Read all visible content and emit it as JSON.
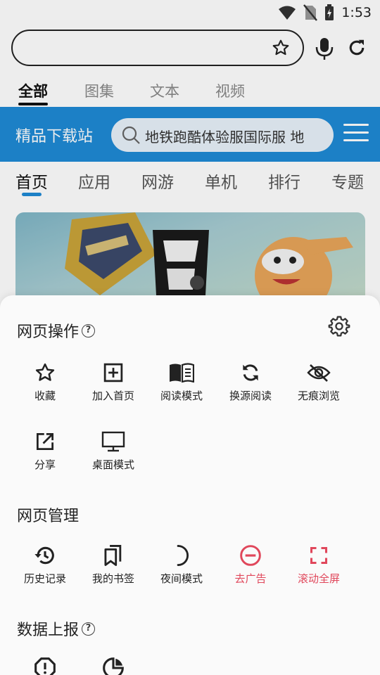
{
  "status_bar": {
    "time": "1:53"
  },
  "browser": {
    "search_value": "",
    "top_tabs": [
      {
        "label": "全部",
        "active": true
      },
      {
        "label": "图集",
        "active": false
      },
      {
        "label": "文本",
        "active": false
      },
      {
        "label": "视频",
        "active": false
      }
    ]
  },
  "site": {
    "title": "精品下载站",
    "search_text": "地铁跑酷体验服国际服 地",
    "nav": [
      {
        "label": "首页",
        "active": true
      },
      {
        "label": "应用"
      },
      {
        "label": "网游"
      },
      {
        "label": "单机"
      },
      {
        "label": "排行"
      },
      {
        "label": "专题"
      }
    ],
    "accent_color": "#1f8ad6"
  },
  "sheet": {
    "sections": [
      {
        "title": "网页操作",
        "items": [
          {
            "label": "收藏",
            "icon": "star-icon"
          },
          {
            "label": "加入首页",
            "icon": "add-square-icon"
          },
          {
            "label": "阅读模式",
            "icon": "book-icon"
          },
          {
            "label": "换源阅读",
            "icon": "sync-icon"
          },
          {
            "label": "无痕浏览",
            "icon": "eye-off-icon"
          },
          {
            "label": "分享",
            "icon": "share-icon"
          },
          {
            "label": "桌面模式",
            "icon": "monitor-icon"
          }
        ]
      },
      {
        "title": "网页管理",
        "items": [
          {
            "label": "历史记录",
            "icon": "history-icon"
          },
          {
            "label": "我的书签",
            "icon": "bookmarks-icon"
          },
          {
            "label": "夜间模式",
            "icon": "moon-icon"
          },
          {
            "label": "去广告",
            "icon": "block-ad-icon",
            "color": "#e0475b"
          },
          {
            "label": "滚动全屏",
            "icon": "fullscreen-icon",
            "color": "#e0475b"
          }
        ]
      },
      {
        "title": "数据上报",
        "items": [
          {
            "label": "",
            "icon": "report-icon"
          },
          {
            "label": "",
            "icon": "pie-chart-icon"
          }
        ]
      }
    ]
  }
}
